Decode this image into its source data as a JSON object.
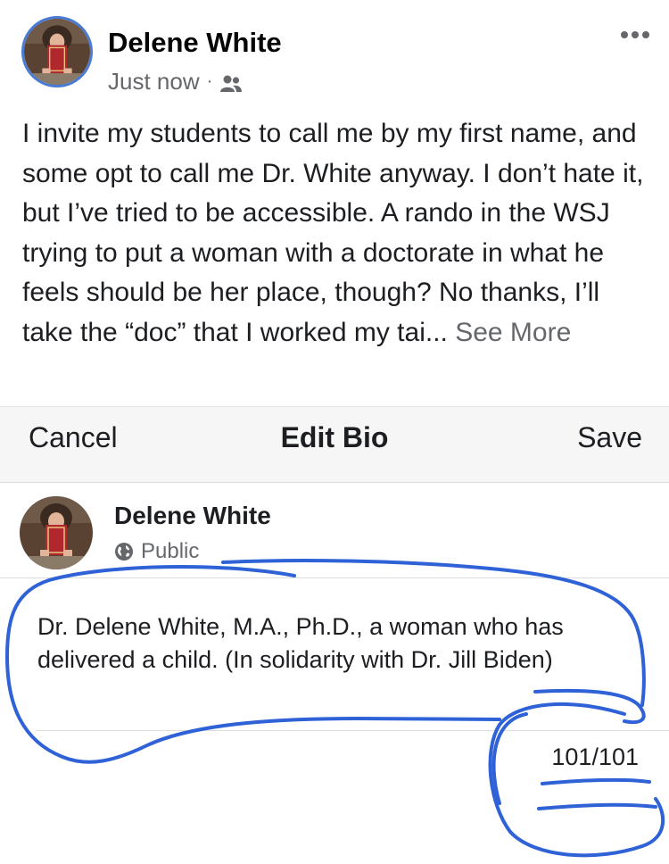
{
  "post": {
    "author": "Delene White",
    "timestamp": "Just now",
    "separator": "·",
    "audience_icon": "friends-icon",
    "more_icon": "more-horizontal-icon",
    "body": "I invite my students to call me by my first name, and some opt to call me Dr. White anyway. I don’t hate it, but I’ve tried to be accessible. A rando in the WSJ trying to put a woman with a doctorate in what he feels should be her place, though? No thanks, I’ll take the “doc” that I worked my tai...",
    "see_more": "See More"
  },
  "edit_bio": {
    "cancel": "Cancel",
    "title": "Edit Bio",
    "save": "Save",
    "name": "Delene White",
    "privacy": "Public",
    "privacy_icon": "globe-icon",
    "bio": "Dr. Delene White, M.A., Ph.D., a woman who has delivered a child. (In solidarity with Dr. Jill Biden)",
    "char_count": "101/101"
  },
  "colors": {
    "marker_blue": "#2f62d6",
    "avatar_ring": "#4a7bd4",
    "muted_text": "#65676b"
  }
}
